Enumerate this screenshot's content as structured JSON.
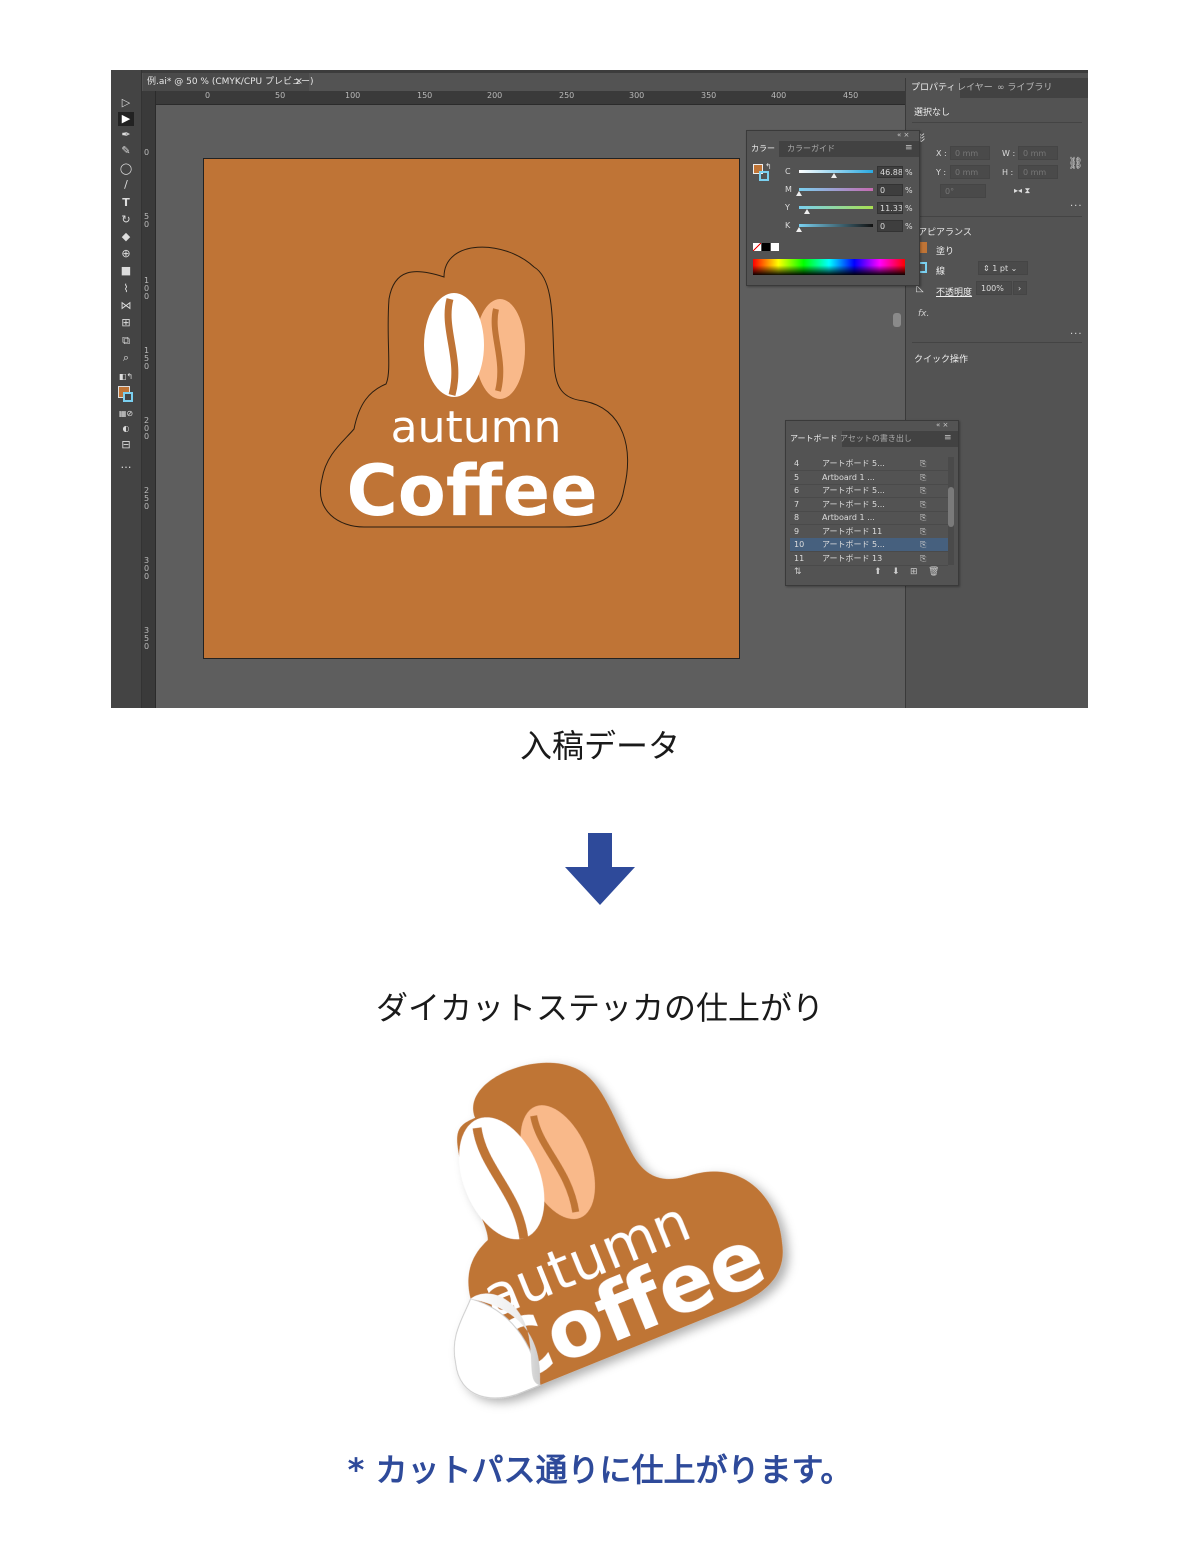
{
  "window": {
    "doc_tab_label": "例.ai* @ 50 % (CMYK/CPU プレビュー)",
    "doc_tab_close": "×"
  },
  "ruler": {
    "horizontal_ticks": [
      "0",
      "50",
      "100",
      "150",
      "200",
      "250",
      "300",
      "350",
      "400",
      "450"
    ],
    "vertical_ticks": [
      "0",
      "50",
      "100",
      "150",
      "200",
      "250",
      "300",
      "350"
    ]
  },
  "artwork": {
    "line1": "autumn",
    "line2": "Coffee",
    "artboard_color": "#bf7436",
    "bean_light_color": "#f9b98a"
  },
  "properties_panel": {
    "tabs": [
      "プロパティ",
      "レイヤー",
      "∞ ライブラリ"
    ],
    "selection": "選択なし",
    "transform_title": "形",
    "x_label": "X :",
    "x_placeholder": "0 mm",
    "w_label": "W :",
    "w_placeholder": "0 mm",
    "y_label": "Y :",
    "y_placeholder": "0 mm",
    "h_label": "H :",
    "h_placeholder": "0 mm",
    "angle_placeholder": "0°",
    "appearance_title": "アピアランス",
    "fill_label": "塗り",
    "stroke_label": "線",
    "stroke_value": "1 pt",
    "opacity_label": "不透明度",
    "opacity_value": "100%",
    "fx_label": "fx.",
    "quick_actions_title": "クイック操作",
    "more": "..."
  },
  "color_panel": {
    "tabs": [
      "カラー",
      "カラーガイド"
    ],
    "sliders": [
      {
        "label": "C",
        "value": "46.88",
        "pos": 0.47
      },
      {
        "label": "M",
        "value": "0",
        "pos": 0.0
      },
      {
        "label": "Y",
        "value": "11.33",
        "pos": 0.11
      },
      {
        "label": "K",
        "value": "0",
        "pos": 0.0
      }
    ],
    "percent": "%"
  },
  "artboards_panel": {
    "tabs": [
      "アートボード",
      "アセットの書き出し"
    ],
    "rows": [
      {
        "num": "4",
        "name": "アートボード 5..."
      },
      {
        "num": "5",
        "name": "Artboard 1 ..."
      },
      {
        "num": "6",
        "name": "アートボード 5..."
      },
      {
        "num": "7",
        "name": "アートボード 5..."
      },
      {
        "num": "8",
        "name": "Artboard 1 ..."
      },
      {
        "num": "9",
        "name": "アートボード 11"
      },
      {
        "num": "10",
        "name": "アートボード 5..."
      },
      {
        "num": "11",
        "name": "アートボード 13"
      }
    ],
    "selected_row": "10"
  },
  "captions": {
    "submitted_data": "入稿データ",
    "finished_sticker": "ダイカットステッカの仕上がり",
    "note": "* カットパス通りに仕上がります。"
  },
  "colors": {
    "arrow": "#2e4a9a",
    "sticker_brown": "#bf7436",
    "note_blue": "#2e4a9a"
  }
}
